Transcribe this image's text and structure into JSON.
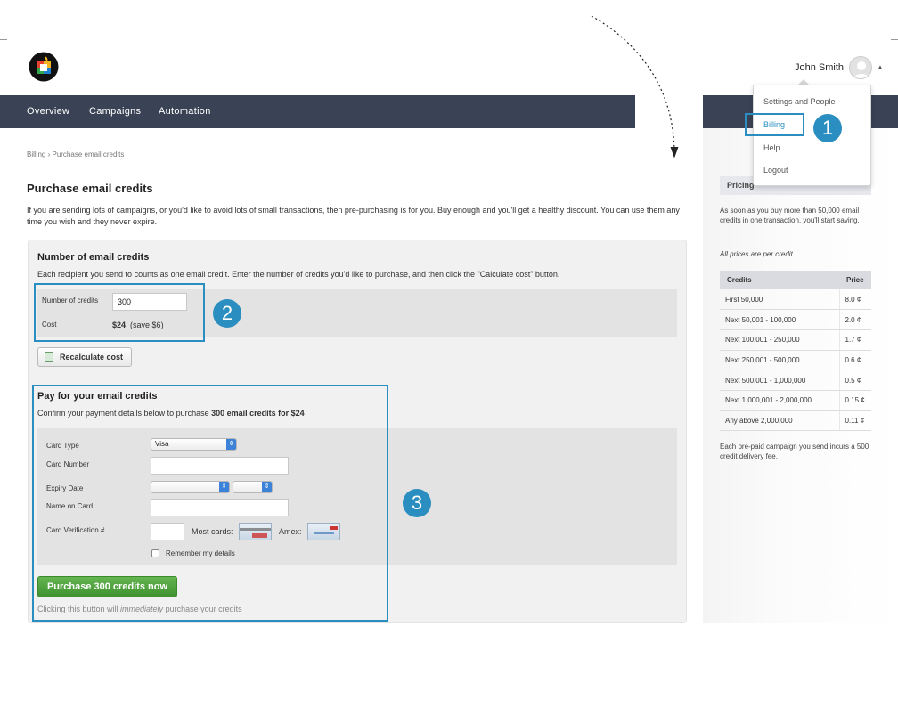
{
  "header": {
    "user_name": "John Smith"
  },
  "nav": {
    "items": [
      {
        "label": "Overview"
      },
      {
        "label": "Campaigns"
      },
      {
        "label": "Automation"
      }
    ]
  },
  "user_menu": {
    "items": [
      {
        "label": "Settings and People"
      },
      {
        "label": "Billing"
      },
      {
        "label": "Help"
      },
      {
        "label": "Logout"
      }
    ]
  },
  "callouts": [
    "1",
    "2",
    "3"
  ],
  "breadcrumb": {
    "parent": "Billing",
    "separator": "›",
    "current": "Purchase email credits"
  },
  "page": {
    "title": "Purchase email credits",
    "intro": "If you are sending lots of campaigns, or you'd like to avoid lots of small transactions, then pre-purchasing is for you. Buy enough and you'll get a healthy discount. You can use them any time you wish and they never expire."
  },
  "credits": {
    "title": "Number of email credits",
    "description": "Each recipient you send to counts as one email credit. Enter the number of credits you'd like to purchase, and then click the \"Calculate cost\" button.",
    "count_label": "Number of credits",
    "count_value": "300",
    "cost_label": "Cost",
    "cost_value": "$24",
    "cost_saving": "(save $6)",
    "recalc_label": "Recalculate cost"
  },
  "payment": {
    "title": "Pay for your email credits",
    "confirm_prefix": "Confirm your payment details below to purchase ",
    "confirm_bold": "300 email credits for $24",
    "card_type_label": "Card Type",
    "card_type_value": "Visa",
    "card_number_label": "Card Number",
    "expiry_label": "Expiry Date",
    "name_label": "Name on Card",
    "cvv_label": "Card Verification #",
    "most_cards_label": "Most cards:",
    "amex_label": "Amex:",
    "remember_label": "Remember my details",
    "remember_checked": false,
    "buy_label": "Purchase 300 credits now",
    "note_prefix": "Clicking this button will ",
    "note_emphasis": "immediately",
    "note_suffix": " purchase your credits"
  },
  "pricing": {
    "title": "Pricing",
    "intro": "As soon as you buy more than 50,000 email credits in one transaction, you'll start saving.",
    "note": "All prices are per credit.",
    "col_credits": "Credits",
    "col_price": "Price",
    "rows": [
      {
        "range": "First 50,000",
        "price": "8.0 ¢"
      },
      {
        "range": "Next 50,001 - 100,000",
        "price": "2.0 ¢"
      },
      {
        "range": "Next 100,001 - 250,000",
        "price": "1.7 ¢"
      },
      {
        "range": "Next 250,001 - 500,000",
        "price": "0.6 ¢"
      },
      {
        "range": "Next 500,001 - 1,000,000",
        "price": "0.5 ¢"
      },
      {
        "range": "Next 1,000,001 - 2,000,000",
        "price": "0.15 ¢"
      },
      {
        "range": "Any above 2,000,000",
        "price": "0.11 ¢"
      }
    ],
    "footer": "Each pre-paid campaign you send incurs a 500 credit delivery fee."
  },
  "colors": {
    "nav_bg": "#3a4355",
    "callout_blue": "#2a8fc0",
    "buy_green": "#4aa33a"
  }
}
